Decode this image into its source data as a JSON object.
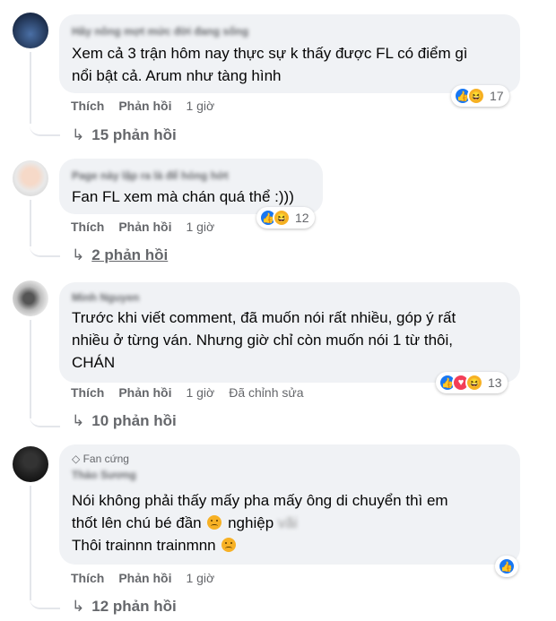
{
  "comments": [
    {
      "name": "Hây nông mợt mức đời đang sống",
      "text_lines": [
        "Xem cả 3 trận hôm nay thực sự k thấy được FL có điểm gì",
        "nổi bật cả. Arum như tàng hình"
      ],
      "like": "Thích",
      "reply": "Phản hồi",
      "time": "1 giờ",
      "edited": "",
      "reaction_count": "17",
      "reactions": [
        "like-icon",
        "haha-icon"
      ],
      "replies": "15 phản hồi"
    },
    {
      "name": "Page này lập ra là để hóng hớt",
      "text_lines": [
        "Fan FL xem mà chán quá thể :)))"
      ],
      "like": "Thích",
      "reply": "Phản hồi",
      "time": "1 giờ",
      "edited": "",
      "reaction_count": "12",
      "reactions": [
        "like-icon",
        "haha-icon"
      ],
      "replies": "2 phản hồi"
    },
    {
      "name": "Minh Nguyen",
      "text_lines": [
        "Trước khi viết comment, đã muốn nói rất nhiều, góp ý rất",
        "nhiều ở từng ván. Nhưng giờ chỉ còn muốn nói 1 từ thôi,",
        "CHÁN"
      ],
      "like": "Thích",
      "reply": "Phản hồi",
      "time": "1 giờ",
      "edited": "Đã chỉnh sửa",
      "reaction_count": "13",
      "reactions": [
        "like-icon",
        "love-icon",
        "haha-icon"
      ],
      "replies": "10 phản hồi"
    },
    {
      "badge": "Fan cứng",
      "name": "Thảo Sương",
      "text_line1": "Nói không phải thấy mấy pha mấy ông di chuyển thì em",
      "text_line2a": "thốt lên chú bé đần",
      "text_line2b": "nghiệp",
      "text_line2c": "vãi",
      "text_line3": "Thôi trainnn trainmnn",
      "like": "Thích",
      "reply": "Phản hồi",
      "time": "1 giờ",
      "reactions": [
        "like-icon"
      ],
      "replies": "12 phản hồi"
    }
  ],
  "colors": {
    "like": "#1877f2",
    "haha": "#f7b125",
    "love": "#f33e58",
    "bubble": "#f0f2f5",
    "meta": "#65676b"
  }
}
